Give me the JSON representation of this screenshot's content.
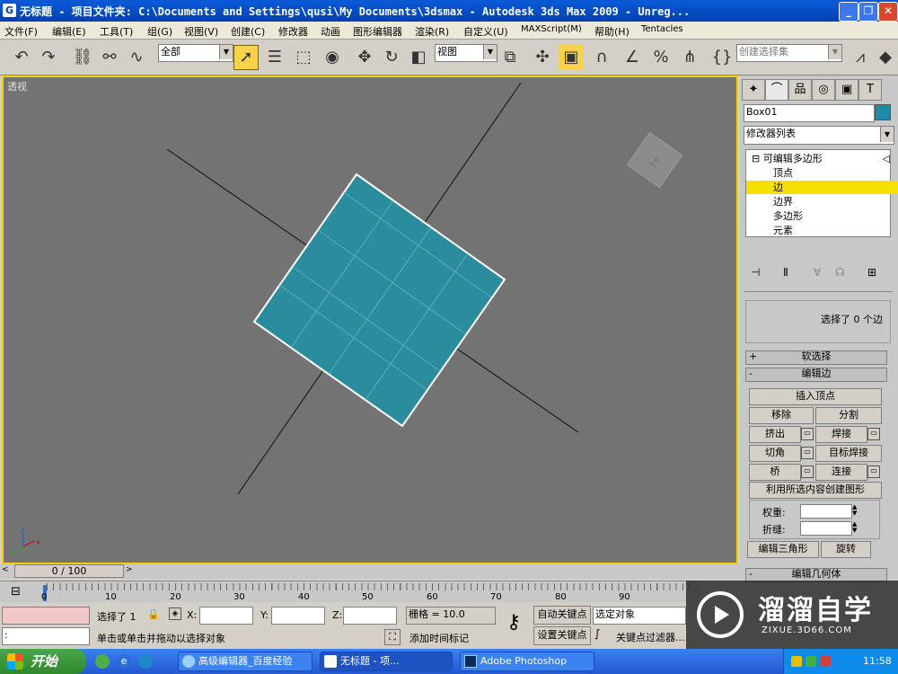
{
  "window": {
    "title": "无标题    - 项目文件夹: C:\\Documents and Settings\\qusi\\My Documents\\3dsmax    - Autodesk 3ds Max  2009   - Unreg...",
    "minimize": "_",
    "restore": "❐",
    "close": "✕"
  },
  "menu": [
    "文件(F)",
    "编辑(E)",
    "工具(T)",
    "组(G)",
    "视图(V)",
    "创建(C)",
    "修改器",
    "动画",
    "图形编辑器",
    "渲染(R)",
    "自定义(U)",
    "MAXScript(M)",
    "帮助(H)",
    "Tentacles"
  ],
  "toolbar": {
    "selection_filter": "全部",
    "reference_coord": "视图",
    "named_selection_placeholder": "创建选择集"
  },
  "viewport": {
    "label": "透视",
    "object_color": "#2a8c9c",
    "axis_x": "x",
    "axis_y": "y",
    "axis_z": "z"
  },
  "command_panel": {
    "object_name": "Box01",
    "object_color": "#1e8ca8",
    "modifier_list": "修改器列表",
    "stack": {
      "root": "可编辑多边形",
      "items": [
        "顶点",
        "边",
        "边界",
        "多边形",
        "元素"
      ],
      "selected": "边"
    },
    "selection_status": "选择了 0 个边",
    "rollouts": {
      "soft_selection": "软选择",
      "edit_edges": "编辑边",
      "edit_geometry": "编辑几何体"
    },
    "buttons": {
      "insert_vertex": "插入顶点",
      "remove": "移除",
      "split": "分割",
      "extrude": "挤出",
      "weld": "焊接",
      "chamfer": "切角",
      "target_weld": "目标焊接",
      "bridge": "桥",
      "connect": "连接",
      "create_shape": "利用所选内容创建图形",
      "edit_tri": "编辑三角形",
      "turn": "旋转"
    },
    "weight_label": "权重:",
    "crease_label": "折缝:"
  },
  "timeline": {
    "frame_display": "0 / 100",
    "ticks": [
      "0",
      "10",
      "20",
      "30",
      "40",
      "50",
      "60",
      "70",
      "80",
      "90"
    ]
  },
  "status": {
    "selection": "选择了 1",
    "prompt": "单击或单击并拖动以选择对象",
    "x_label": "X:",
    "y_label": "Y:",
    "z_label": "Z:",
    "grid": "栅格 = 10.0",
    "auto_key": "自动关键点",
    "set_key": "设置关键点",
    "selected_object": "选定对象",
    "key_filters": "关键点过滤器...",
    "add_time_tag": "添加时间标记",
    "maxscript": ":"
  },
  "taskbar": {
    "start": "开始",
    "items": [
      "高级编辑器_百度经验",
      "无标题      - 项...",
      "Adobe Photoshop"
    ],
    "clock": "11:58"
  },
  "watermark": {
    "brand": "溜溜自学",
    "url": "ZIXUE.3D66.COM"
  }
}
